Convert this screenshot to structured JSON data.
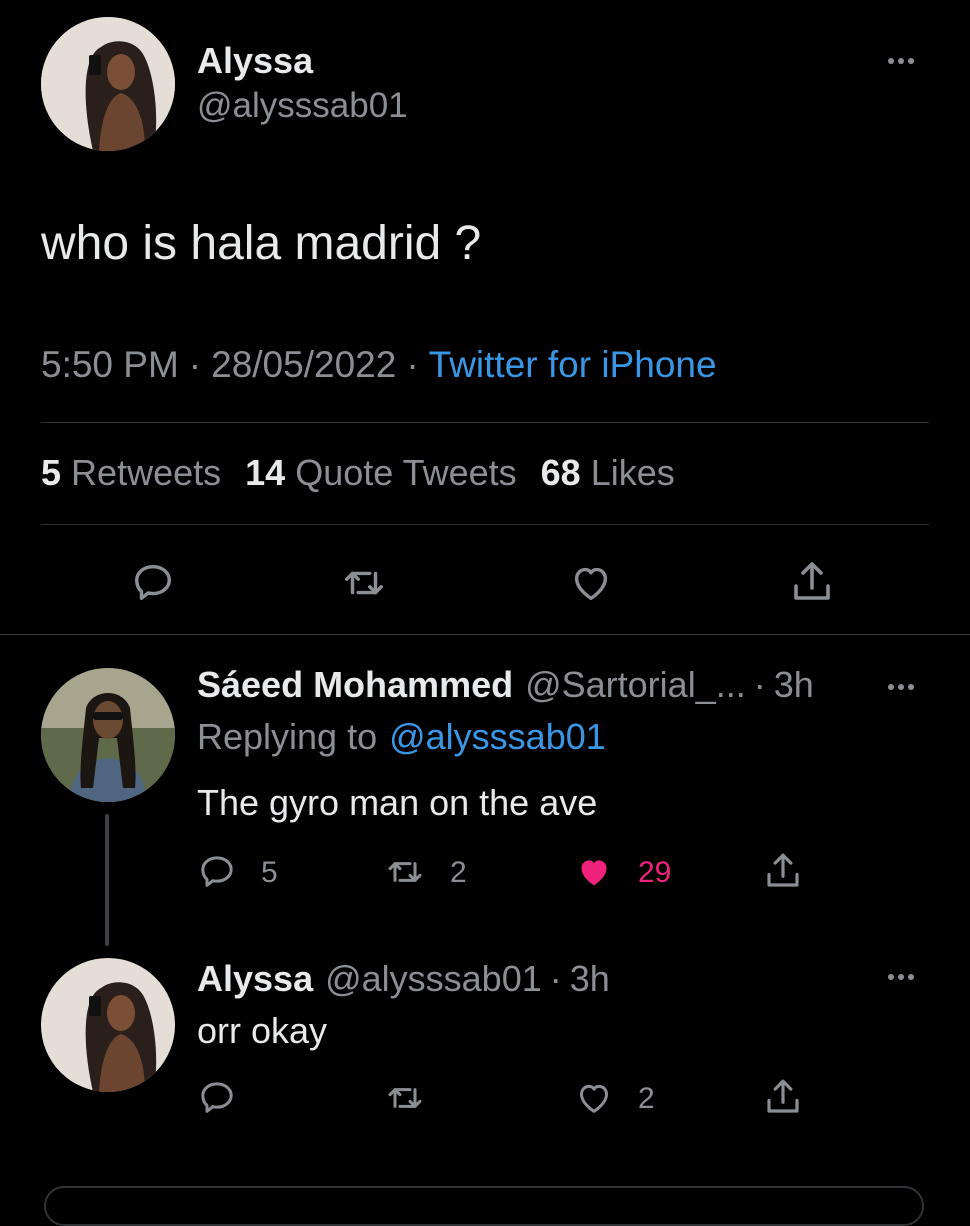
{
  "main_tweet": {
    "author_name": "Alyssa",
    "author_handle": "@alysssab01",
    "text": "who is hala madrid ?",
    "time": "5:50 PM",
    "date": "28/05/2022",
    "source": "Twitter for iPhone",
    "separator": "·",
    "stats": {
      "retweets_count": "5",
      "retweets_label": "Retweets",
      "quotes_count": "14",
      "quotes_label": "Quote Tweets",
      "likes_count": "68",
      "likes_label": "Likes"
    }
  },
  "replies": [
    {
      "author_name": "Sáeed Mohammed",
      "author_handle": "@Sartorial_...",
      "separator": "·",
      "time": "3h",
      "replying_label": "Replying to",
      "replying_handle": "@alysssab01",
      "text": "The gyro man on the ave",
      "reply_count": "5",
      "retweet_count": "2",
      "like_count": "29",
      "liked": true
    },
    {
      "author_name": "Alyssa",
      "author_handle": "@alysssab01",
      "separator": "·",
      "time": "3h",
      "text": "orr okay",
      "reply_count": "",
      "retweet_count": "",
      "like_count": "2",
      "liked": false
    }
  ],
  "colors": {
    "background": "#000000",
    "text": "#e7e9ea",
    "secondary": "#8b8f94",
    "link": "#3a97e6",
    "like_active": "#f0237c"
  },
  "icons": [
    "more-icon",
    "reply-icon",
    "retweet-icon",
    "like-icon",
    "share-icon"
  ]
}
